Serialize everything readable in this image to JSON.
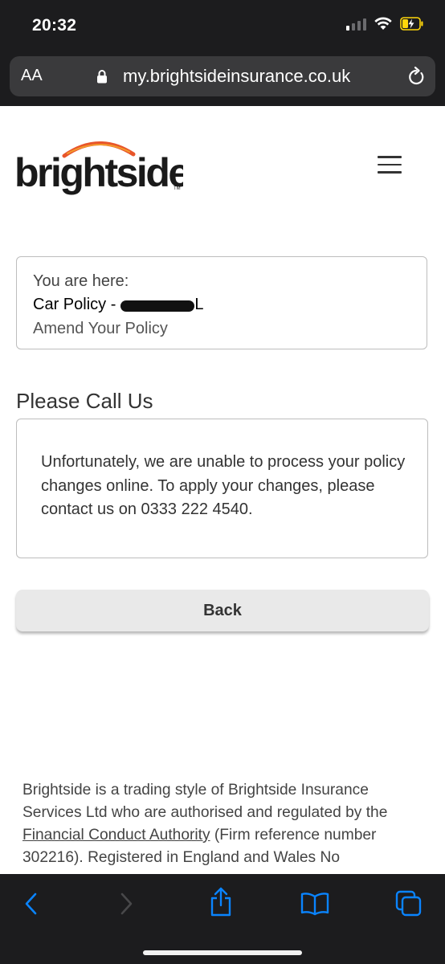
{
  "status_bar": {
    "time": "20:32"
  },
  "browser": {
    "text_size_label": "AA",
    "url": "my.brightsideinsurance.co.uk"
  },
  "header": {
    "logo_text": "brightside",
    "logo_tm": "TM"
  },
  "breadcrumb": {
    "label": "You are here:",
    "policy_prefix": "Car Policy -",
    "policy_suffix": "L",
    "current_page": "Amend Your Policy"
  },
  "section": {
    "title": "Please Call Us",
    "message": "Unfortunately, we are unable to process your policy changes online. To apply your changes, please contact us on 0333 222 4540."
  },
  "actions": {
    "back_label": "Back"
  },
  "footer": {
    "text_before_link": "Brightside is a trading style of Brightside Insurance Services Ltd who are authorised and regulated by the ",
    "link_text": "Financial Conduct Authority",
    "text_after_link": " (Firm reference number 302216). Registered in England and Wales No"
  },
  "colors": {
    "browser_chrome": "#1c1c1e",
    "toolbar_blue": "#0a84ff",
    "logo_orange": "#e8552a",
    "battery_yellow": "#ffd60a"
  }
}
